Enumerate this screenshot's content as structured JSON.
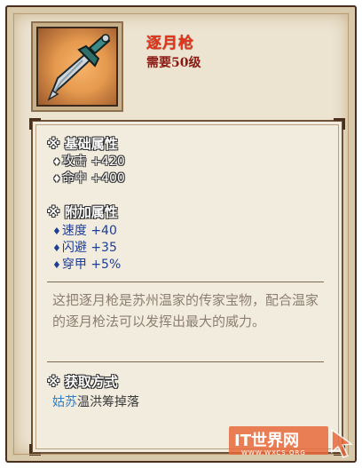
{
  "item": {
    "name": "逐月枪",
    "requirement": "需要50级",
    "icon": "spear-icon"
  },
  "base_section": {
    "title": "※ 基础属性",
    "attributes": [
      {
        "label": "攻击",
        "value": "+420"
      },
      {
        "label": "命中",
        "value": "+400"
      }
    ]
  },
  "extra_section": {
    "title": "※ 附加属性",
    "attributes": [
      {
        "label": "速度",
        "value": "+40"
      },
      {
        "label": "闪避",
        "value": "+35"
      },
      {
        "label": "穿甲",
        "value": "+5%"
      }
    ]
  },
  "description": "这把逐月枪是苏州温家的传家宝物，配合温家的逐月枪法可以发挥出最大的威力。",
  "source_section": {
    "title": "※ 获取方式",
    "place": "姑苏",
    "rest": "温洪筹掉落"
  },
  "watermark": {
    "text": "IT世界网",
    "url": "WWW.WXCS.ORG"
  },
  "colors": {
    "name": "#e2361c",
    "requirement": "#8d1a12",
    "attr_extra": "#1e3d96",
    "link": "#2f7fc4"
  }
}
